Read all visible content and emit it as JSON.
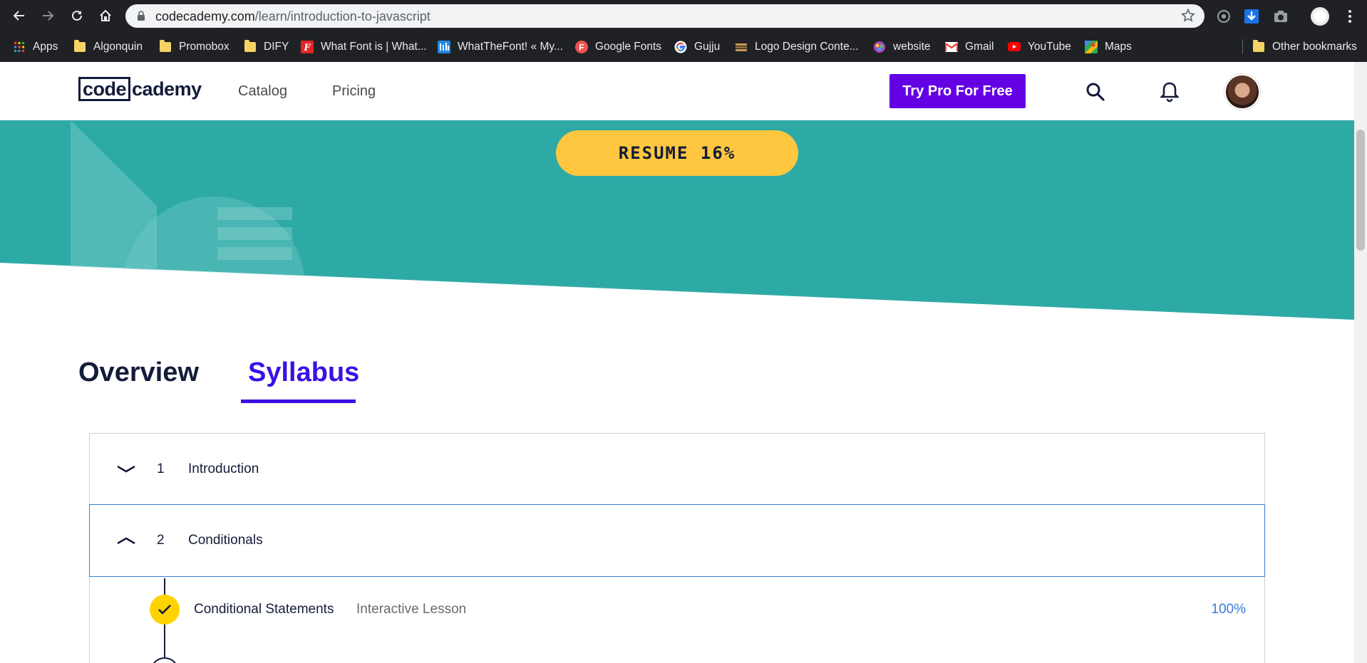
{
  "browser": {
    "url_host": "codecademy.com",
    "url_path": "/learn/introduction-to-javascript",
    "bookmarks": [
      {
        "label": "Apps",
        "icon": "apps-grid-icon"
      },
      {
        "label": "Algonquin",
        "icon": "folder-icon"
      },
      {
        "label": "Promobox",
        "icon": "folder-icon"
      },
      {
        "label": "DIFY",
        "icon": "folder-icon"
      },
      {
        "label": "What Font is | What...",
        "icon": "whatfontis-icon"
      },
      {
        "label": "WhatTheFont! « My...",
        "icon": "whatthefont-icon"
      },
      {
        "label": "Google Fonts",
        "icon": "google-fonts-icon"
      },
      {
        "label": "Gujju",
        "icon": "google-icon"
      },
      {
        "label": "Logo Design Conte...",
        "icon": "logo-design-icon"
      },
      {
        "label": "website",
        "icon": "website-icon"
      },
      {
        "label": "Gmail",
        "icon": "gmail-icon"
      },
      {
        "label": "YouTube",
        "icon": "youtube-icon"
      },
      {
        "label": "Maps",
        "icon": "maps-icon"
      }
    ],
    "other_bookmarks": "Other bookmarks"
  },
  "header": {
    "logo_code": "code",
    "logo_academy": "cademy",
    "nav": [
      "Catalog",
      "Pricing"
    ],
    "cta": "Try Pro For Free"
  },
  "hero": {
    "resume_label": "RESUME 16%",
    "progress_percent": 16
  },
  "tabs": {
    "overview": "Overview",
    "syllabus": "Syllabus",
    "active": "Syllabus"
  },
  "syllabus": {
    "modules": [
      {
        "number": "1",
        "title": "Introduction",
        "expanded": false
      },
      {
        "number": "2",
        "title": "Conditionals",
        "expanded": true
      }
    ],
    "lessons": [
      {
        "title": "Conditional Statements",
        "type": "Interactive Lesson",
        "progress": "100%",
        "completed": true
      }
    ]
  },
  "colors": {
    "hero_teal": "#2eaaa6",
    "resume_yellow": "#ffc740",
    "cta_purple": "#6400e4",
    "syllabus_blue": "#3a10e5",
    "progress_blue": "#3a7bd5",
    "check_yellow": "#ffd300"
  }
}
